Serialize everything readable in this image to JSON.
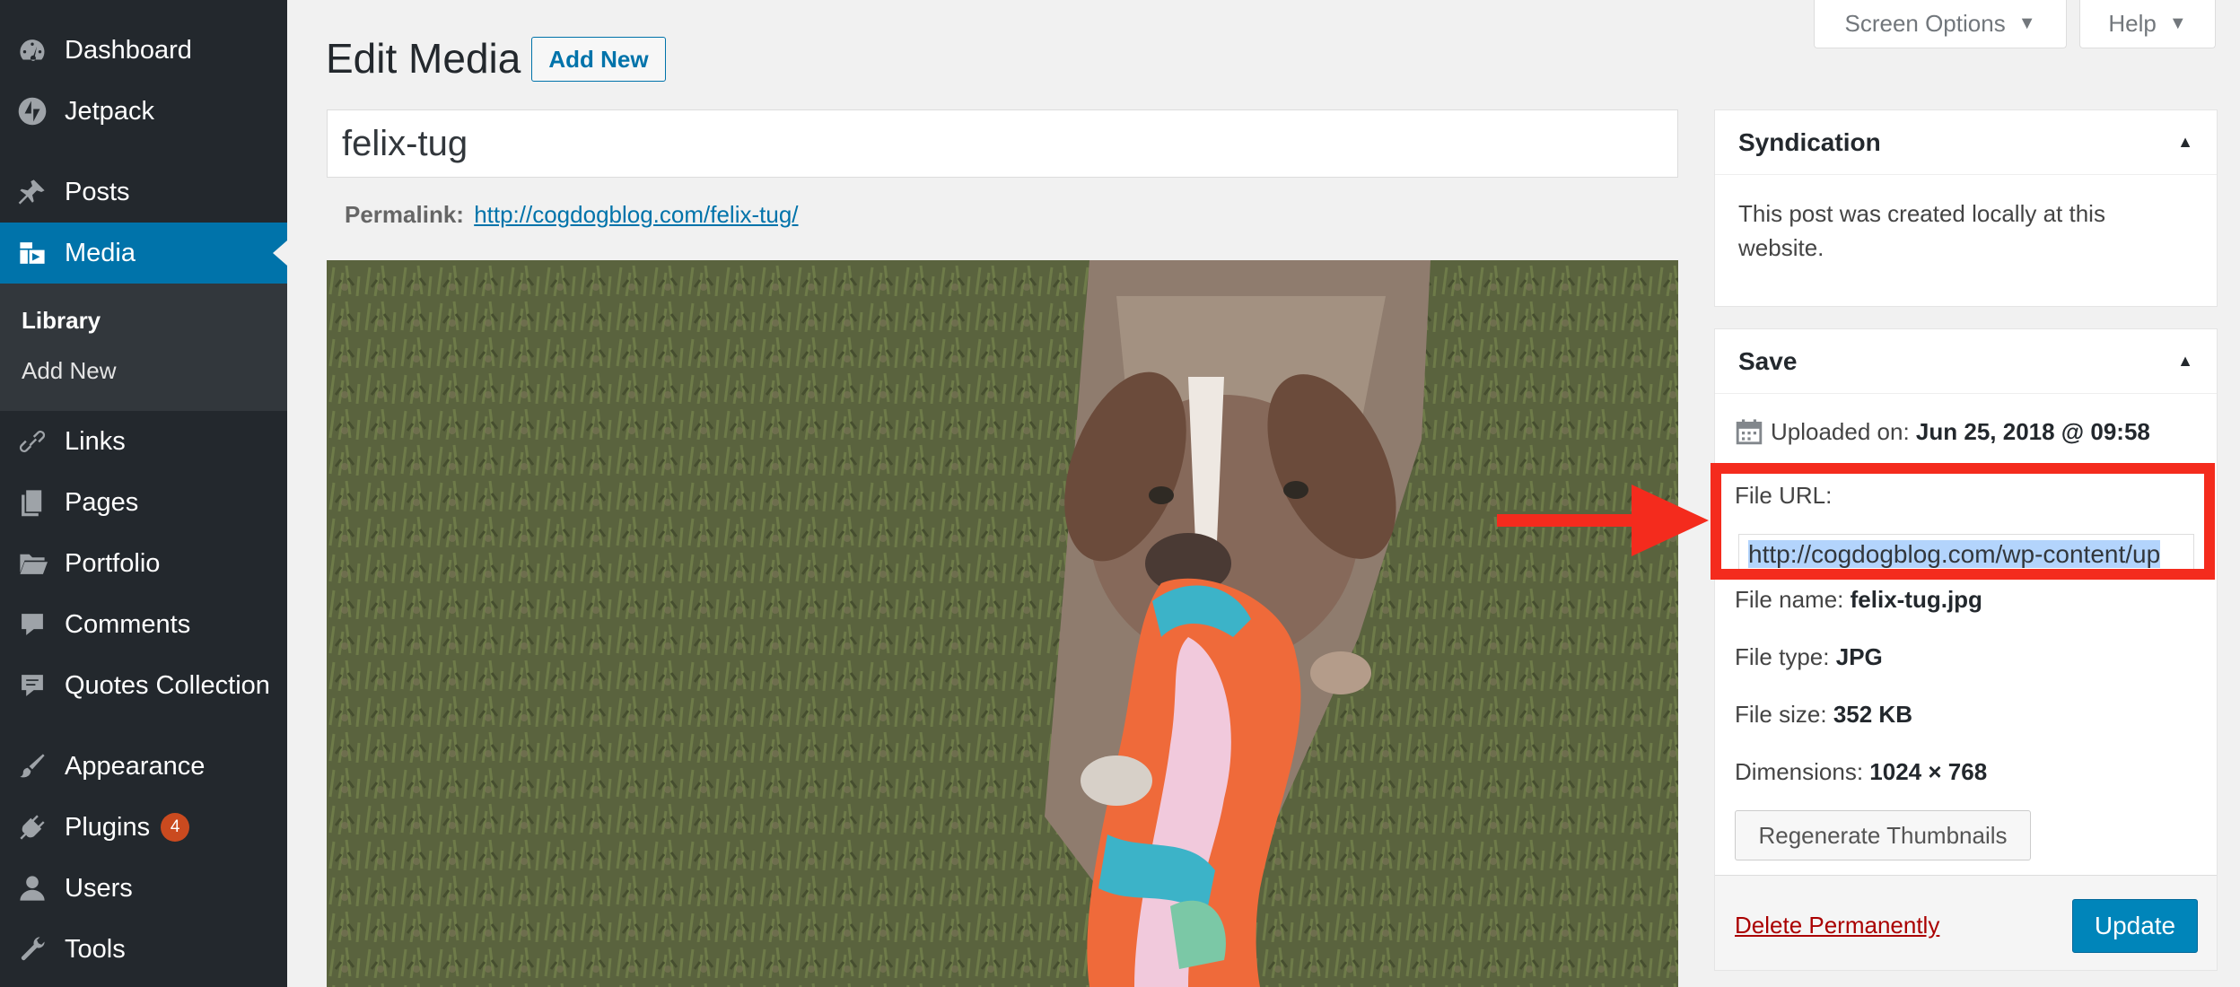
{
  "sidebar": {
    "items": [
      {
        "label": "Dashboard",
        "icon": "dashboard-icon"
      },
      {
        "label": "Jetpack",
        "icon": "jetpack-icon"
      },
      {
        "label": "Posts",
        "icon": "pin-icon"
      },
      {
        "label": "Media",
        "icon": "media-icon"
      },
      {
        "label": "Links",
        "icon": "link-icon"
      },
      {
        "label": "Pages",
        "icon": "pages-icon"
      },
      {
        "label": "Portfolio",
        "icon": "folder-icon"
      },
      {
        "label": "Comments",
        "icon": "comment-icon"
      },
      {
        "label": "Quotes Collection",
        "icon": "quote-icon"
      },
      {
        "label": "Appearance",
        "icon": "brush-icon"
      },
      {
        "label": "Plugins",
        "icon": "plugin-icon",
        "badge": "4"
      },
      {
        "label": "Users",
        "icon": "user-icon"
      },
      {
        "label": "Tools",
        "icon": "wrench-icon"
      }
    ],
    "submenu": {
      "library": "Library",
      "add_new": "Add New"
    }
  },
  "screen_meta": {
    "screen_options": "Screen Options",
    "help": "Help"
  },
  "header": {
    "title": "Edit Media",
    "add_new": "Add New"
  },
  "post": {
    "title": "felix-tug",
    "permalink_label": "Permalink:",
    "permalink_url": "http://cogdogblog.com/felix-tug/"
  },
  "syndication": {
    "title": "Syndication",
    "text": "This post was created locally at this website."
  },
  "save_box": {
    "title": "Save",
    "uploaded_label": "Uploaded on:",
    "uploaded_value": "Jun 25, 2018 @ 09:58",
    "file_url_label": "File URL:",
    "file_url_value": "http://cogdogblog.com/wp-content/up",
    "file_name_label": "File name:",
    "file_name_value": "felix-tug.jpg",
    "file_type_label": "File type:",
    "file_type_value": "JPG",
    "file_size_label": "File size:",
    "file_size_value": "352 KB",
    "dimensions_label": "Dimensions:",
    "dimensions_value": "1024 × 768",
    "regenerate": "Regenerate Thumbnails",
    "delete": "Delete Permanently",
    "update": "Update"
  },
  "colors": {
    "sidebar_bg": "#23282d",
    "accent": "#0073aa",
    "highlight": "#f42b1d",
    "badge": "#ca4a1f"
  }
}
